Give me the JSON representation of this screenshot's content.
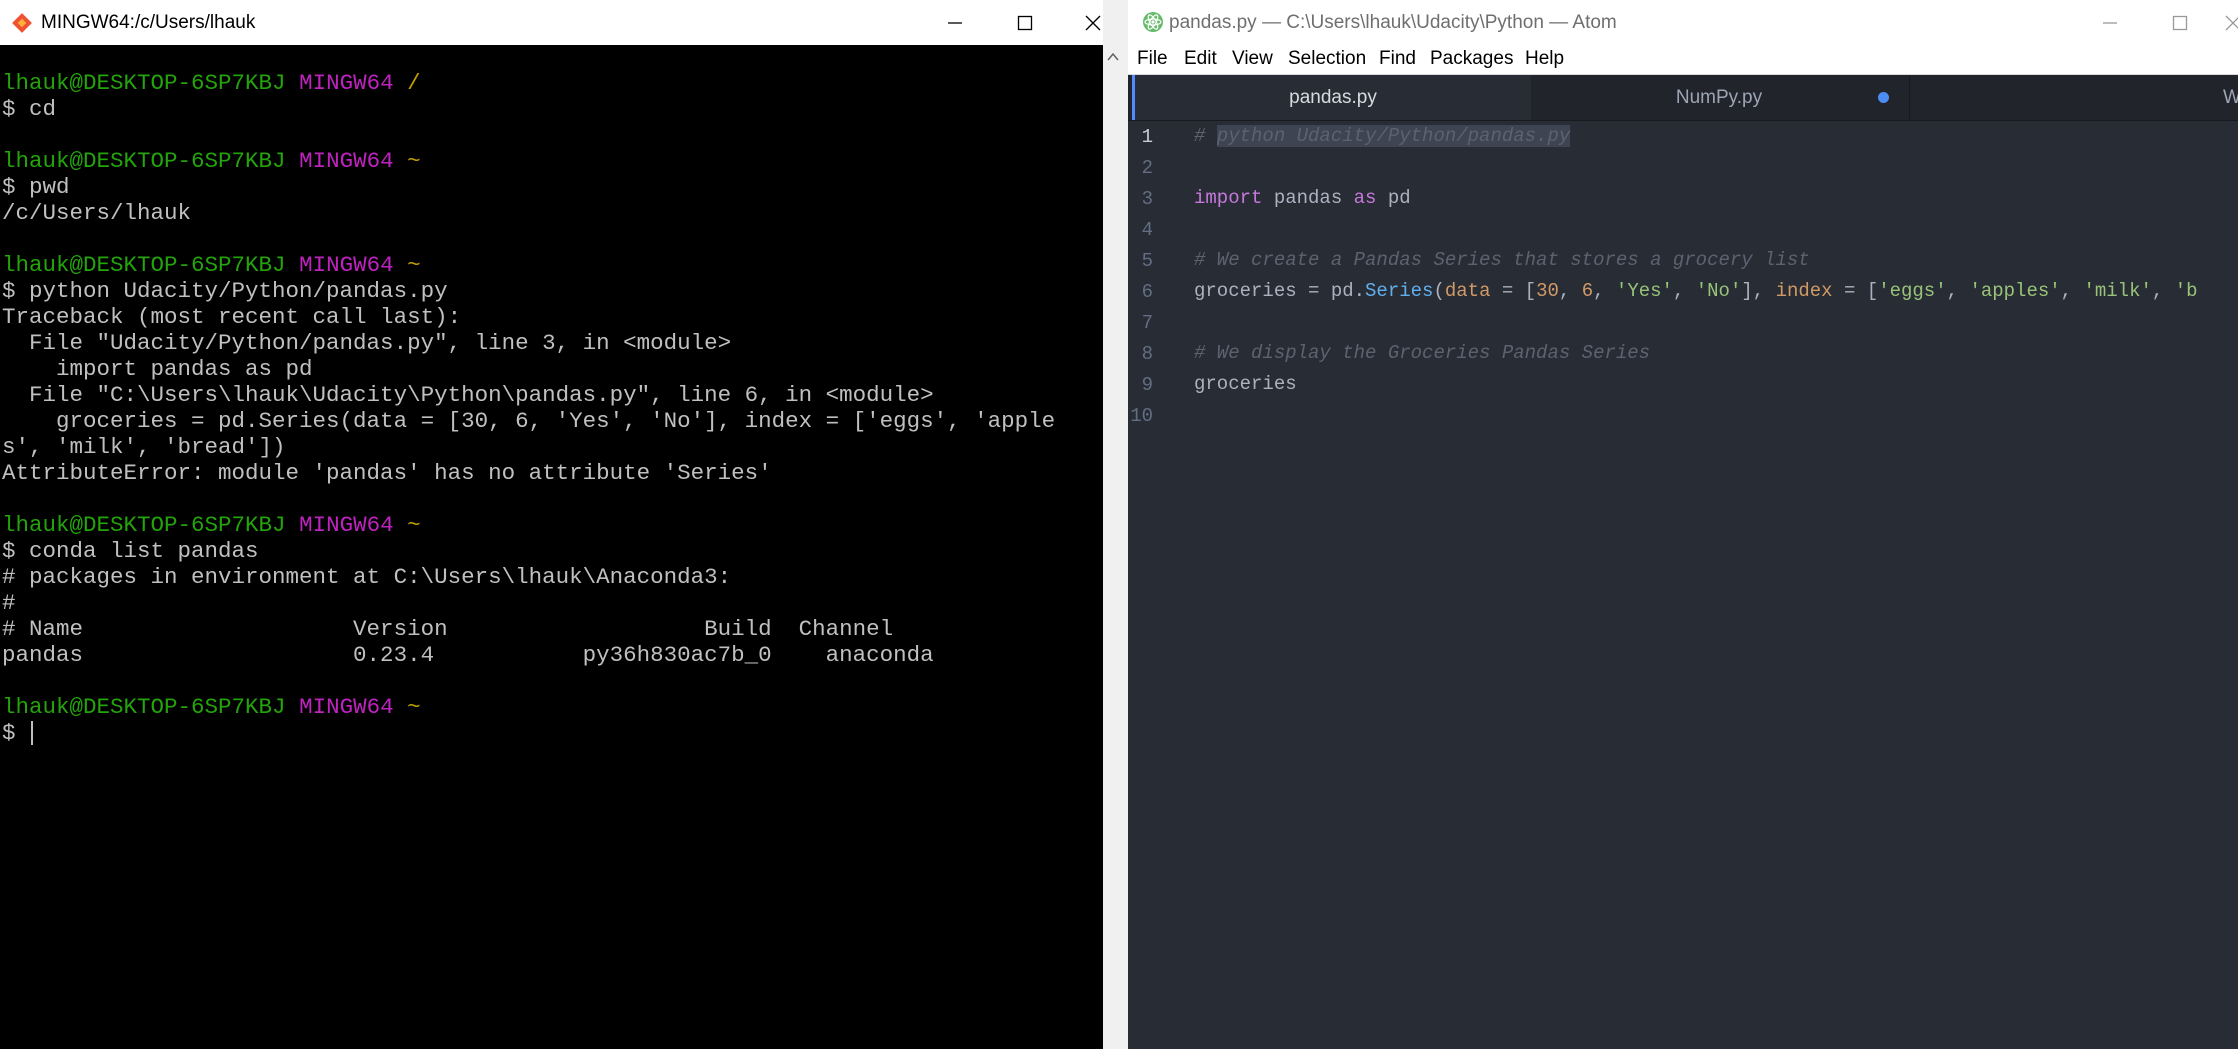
{
  "terminal": {
    "title": "MINGW64:/c/Users/lhauk",
    "lines": [
      {
        "parts": [
          {
            "t": "lhauk@DESKTOP-6SP7KBJ ",
            "c": "t-user"
          },
          {
            "t": "MINGW64 ",
            "c": "t-host"
          },
          {
            "t": "/",
            "c": "t-path"
          }
        ]
      },
      {
        "parts": [
          {
            "t": "$ cd",
            "c": ""
          }
        ]
      },
      {
        "parts": []
      },
      {
        "parts": [
          {
            "t": "lhauk@DESKTOP-6SP7KBJ ",
            "c": "t-user"
          },
          {
            "t": "MINGW64 ",
            "c": "t-host"
          },
          {
            "t": "~",
            "c": "t-path"
          }
        ]
      },
      {
        "parts": [
          {
            "t": "$ pwd",
            "c": ""
          }
        ]
      },
      {
        "parts": [
          {
            "t": "/c/Users/lhauk",
            "c": ""
          }
        ]
      },
      {
        "parts": []
      },
      {
        "parts": [
          {
            "t": "lhauk@DESKTOP-6SP7KBJ ",
            "c": "t-user"
          },
          {
            "t": "MINGW64 ",
            "c": "t-host"
          },
          {
            "t": "~",
            "c": "t-path"
          }
        ]
      },
      {
        "parts": [
          {
            "t": "$ python Udacity/Python/pandas.py",
            "c": ""
          }
        ]
      },
      {
        "parts": [
          {
            "t": "Traceback (most recent call last):",
            "c": ""
          }
        ]
      },
      {
        "parts": [
          {
            "t": "  File \"Udacity/Python/pandas.py\", line 3, in <module>",
            "c": ""
          }
        ]
      },
      {
        "parts": [
          {
            "t": "    import pandas as pd",
            "c": ""
          }
        ]
      },
      {
        "parts": [
          {
            "t": "  File \"C:\\Users\\lhauk\\Udacity\\Python\\pandas.py\", line 6, in <module>",
            "c": ""
          }
        ]
      },
      {
        "parts": [
          {
            "t": "    groceries = pd.Series(data = [30, 6, 'Yes', 'No'], index = ['eggs', 'apple",
            "c": ""
          }
        ]
      },
      {
        "parts": [
          {
            "t": "s', 'milk', 'bread'])",
            "c": ""
          }
        ]
      },
      {
        "parts": [
          {
            "t": "AttributeError: module 'pandas' has no attribute 'Series'",
            "c": ""
          }
        ]
      },
      {
        "parts": []
      },
      {
        "parts": [
          {
            "t": "lhauk@DESKTOP-6SP7KBJ ",
            "c": "t-user"
          },
          {
            "t": "MINGW64 ",
            "c": "t-host"
          },
          {
            "t": "~",
            "c": "t-path"
          }
        ]
      },
      {
        "parts": [
          {
            "t": "$ conda list pandas",
            "c": ""
          }
        ]
      },
      {
        "parts": [
          {
            "t": "# packages in environment at C:\\Users\\lhauk\\Anaconda3:",
            "c": ""
          }
        ]
      },
      {
        "parts": [
          {
            "t": "#",
            "c": ""
          }
        ]
      },
      {
        "parts": [
          {
            "t": "# Name                    Version                   Build  Channel",
            "c": ""
          }
        ]
      },
      {
        "parts": [
          {
            "t": "pandas                    0.23.4           py36h830ac7b_0    anaconda",
            "c": ""
          }
        ]
      },
      {
        "parts": []
      },
      {
        "parts": [
          {
            "t": "lhauk@DESKTOP-6SP7KBJ ",
            "c": "t-user"
          },
          {
            "t": "MINGW64 ",
            "c": "t-host"
          },
          {
            "t": "~",
            "c": "t-path"
          }
        ]
      },
      {
        "parts": [
          {
            "t": "$ ",
            "c": ""
          }
        ],
        "cursor": true
      }
    ]
  },
  "atom": {
    "title": "pandas.py — C:\\Users\\lhauk\\Udacity\\Python — Atom",
    "menu": [
      "File",
      "Edit",
      "View",
      "Selection",
      "Find",
      "Packages",
      "Help"
    ],
    "tabs": [
      {
        "label": "pandas.py",
        "active": true
      },
      {
        "label": "NumPy.py",
        "modified": true
      },
      {
        "label": "W"
      }
    ],
    "active_line": 1,
    "code": [
      {
        "n": "1",
        "parts": [
          {
            "t": "# ",
            "c": "c-comment"
          },
          {
            "t": "python Udacity/Python/pandas.py",
            "c": "c-comment c-sel"
          }
        ]
      },
      {
        "n": "2",
        "parts": []
      },
      {
        "n": "3",
        "parts": [
          {
            "t": "import",
            "c": "c-kw"
          },
          {
            "t": " pandas ",
            "c": ""
          },
          {
            "t": "as",
            "c": "c-kw"
          },
          {
            "t": " pd",
            "c": ""
          }
        ]
      },
      {
        "n": "4",
        "parts": []
      },
      {
        "n": "5",
        "parts": [
          {
            "t": "# We create a Pandas Series that stores a grocery list",
            "c": "c-comment"
          }
        ]
      },
      {
        "n": "6",
        "parts": [
          {
            "t": "groceries = pd.",
            "c": ""
          },
          {
            "t": "Series",
            "c": "c-fn"
          },
          {
            "t": "(",
            "c": ""
          },
          {
            "t": "data",
            "c": "c-param"
          },
          {
            "t": " = [",
            "c": ""
          },
          {
            "t": "30",
            "c": "c-num"
          },
          {
            "t": ", ",
            "c": ""
          },
          {
            "t": "6",
            "c": "c-num"
          },
          {
            "t": ", ",
            "c": ""
          },
          {
            "t": "'Yes'",
            "c": "c-str"
          },
          {
            "t": ", ",
            "c": ""
          },
          {
            "t": "'No'",
            "c": "c-str"
          },
          {
            "t": "], ",
            "c": ""
          },
          {
            "t": "index",
            "c": "c-param"
          },
          {
            "t": " = [",
            "c": ""
          },
          {
            "t": "'eggs'",
            "c": "c-str"
          },
          {
            "t": ", ",
            "c": ""
          },
          {
            "t": "'apples'",
            "c": "c-str"
          },
          {
            "t": ", ",
            "c": ""
          },
          {
            "t": "'milk'",
            "c": "c-str"
          },
          {
            "t": ", ",
            "c": ""
          },
          {
            "t": "'b",
            "c": "c-str"
          }
        ]
      },
      {
        "n": "7",
        "parts": []
      },
      {
        "n": "8",
        "parts": [
          {
            "t": "# We display the Groceries Pandas Series",
            "c": "c-comment"
          }
        ]
      },
      {
        "n": "9",
        "parts": [
          {
            "t": "groceries",
            "c": ""
          }
        ]
      },
      {
        "n": "10",
        "parts": []
      }
    ]
  }
}
